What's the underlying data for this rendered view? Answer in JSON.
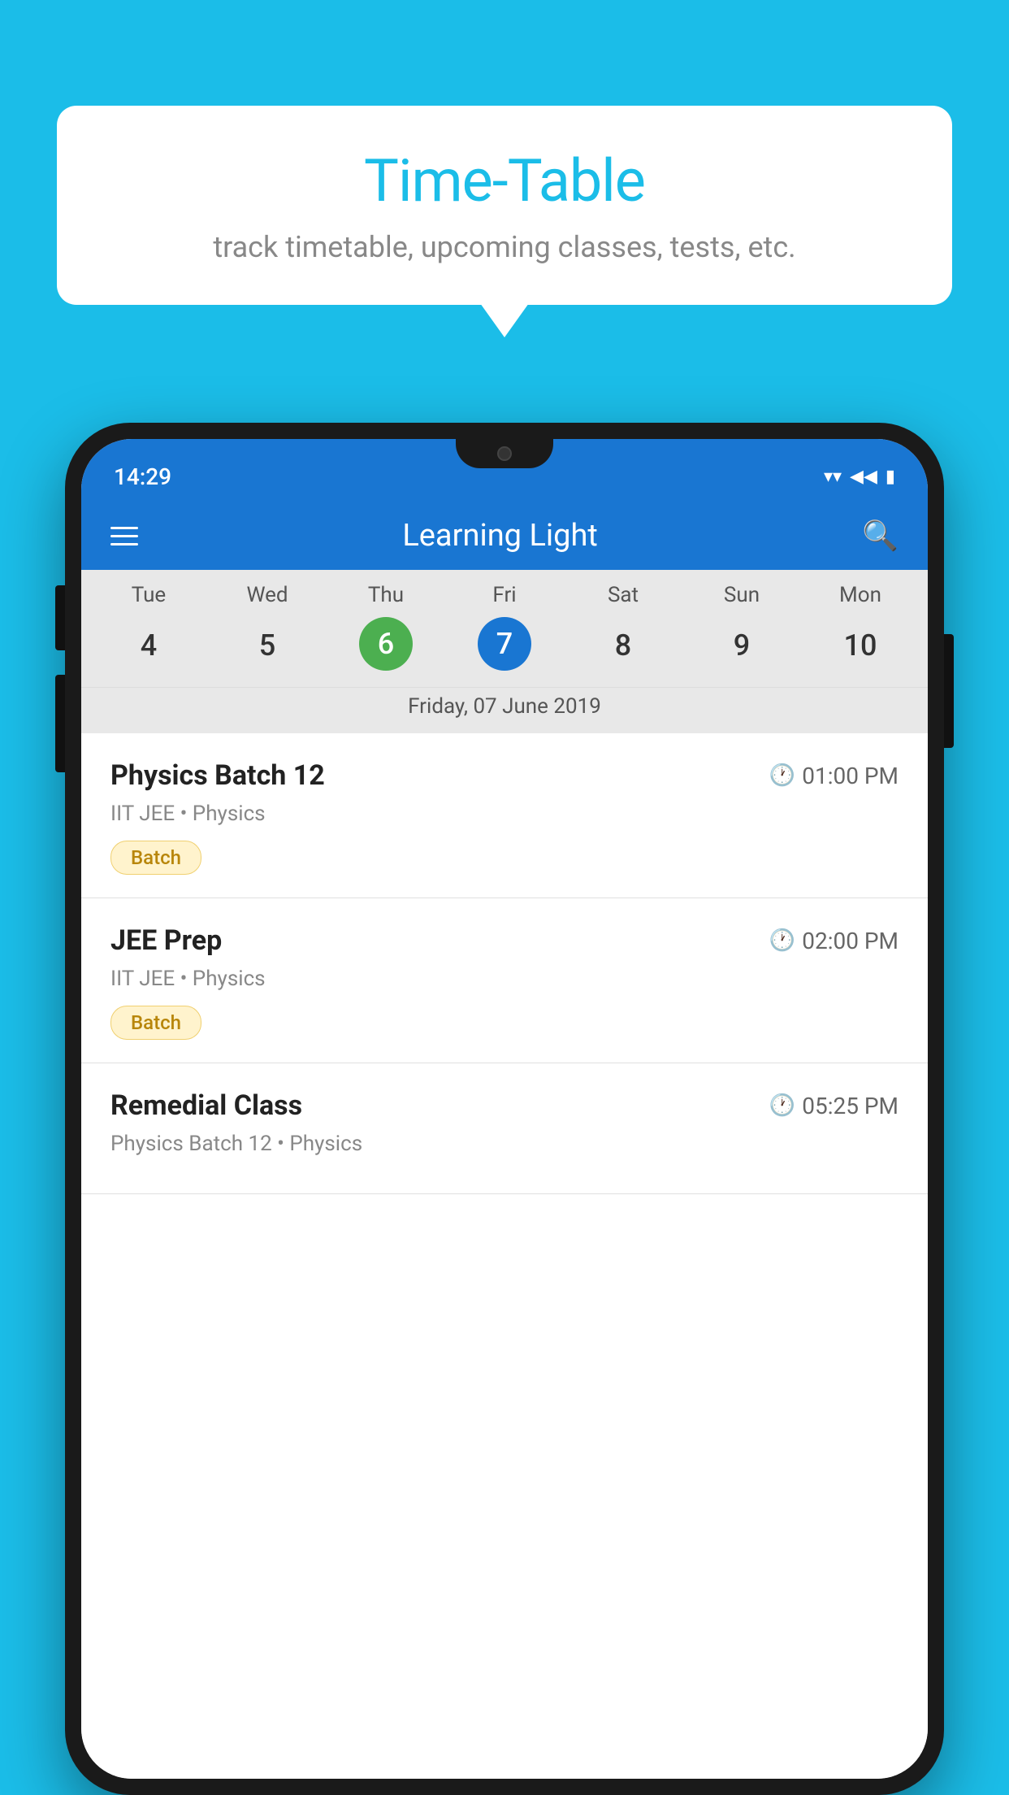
{
  "background_color": "#1BBDE8",
  "speech_bubble": {
    "title": "Time-Table",
    "subtitle": "track timetable, upcoming classes, tests, etc."
  },
  "status_bar": {
    "time": "14:29"
  },
  "app_bar": {
    "title": "Learning Light"
  },
  "calendar": {
    "days": [
      "Tue",
      "Wed",
      "Thu",
      "Fri",
      "Sat",
      "Sun",
      "Mon"
    ],
    "dates": [
      "4",
      "5",
      "6",
      "7",
      "8",
      "9",
      "10"
    ],
    "today_index": 2,
    "selected_index": 3,
    "selected_date_label": "Friday, 07 June 2019"
  },
  "classes": [
    {
      "name": "Physics Batch 12",
      "time": "01:00 PM",
      "subtitle": "IIT JEE • Physics",
      "badge": "Batch"
    },
    {
      "name": "JEE Prep",
      "time": "02:00 PM",
      "subtitle": "IIT JEE • Physics",
      "badge": "Batch"
    },
    {
      "name": "Remedial Class",
      "time": "05:25 PM",
      "subtitle": "Physics Batch 12 • Physics",
      "badge": null
    }
  ],
  "icons": {
    "hamburger": "≡",
    "search": "🔍",
    "clock": "🕐",
    "wifi": "▲",
    "signal": "▲",
    "battery": "▮"
  }
}
